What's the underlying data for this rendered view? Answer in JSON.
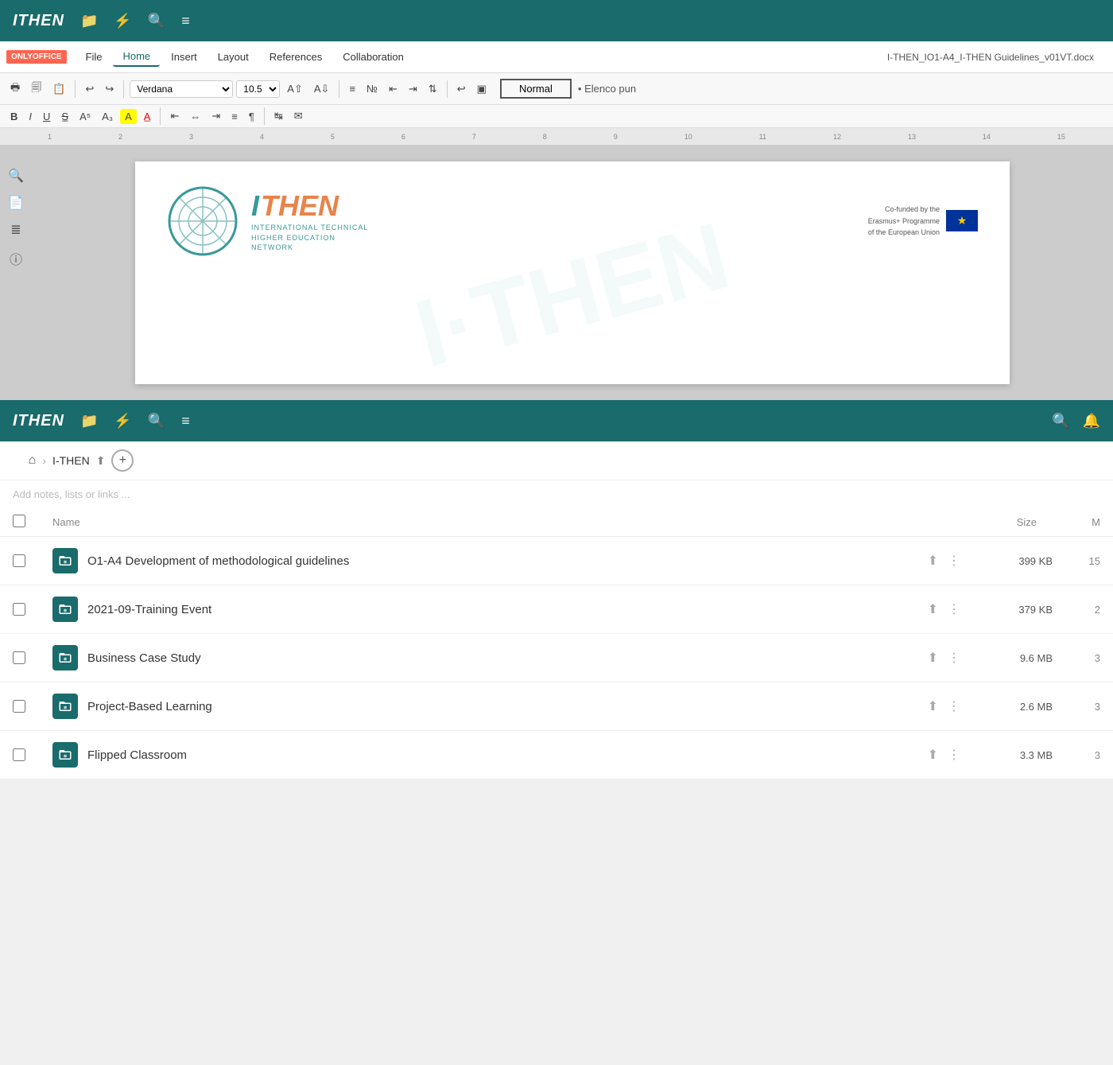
{
  "app": {
    "logo": "ITHEN",
    "icons": [
      "folder",
      "bolt",
      "search",
      "list"
    ]
  },
  "editor": {
    "onlyoffice_label": "ONLYOFFICE",
    "menu": {
      "items": [
        {
          "label": "File",
          "active": false
        },
        {
          "label": "Home",
          "active": true
        },
        {
          "label": "Insert",
          "active": false
        },
        {
          "label": "Layout",
          "active": false
        },
        {
          "label": "References",
          "active": false
        },
        {
          "label": "Collaboration",
          "active": false
        }
      ],
      "doc_title": "I-THEN_IO1-A4_I-THEN Guidelines_v01VT.docx"
    },
    "toolbar": {
      "font": "Verdana",
      "font_size": "10.5",
      "style": "Normal",
      "style2": "• Elenco pun"
    },
    "document": {
      "logo_i": "I",
      "logo_then": "THEN",
      "logo_subtitle_line1": "INTERNATIONAL TECHNICAL",
      "logo_subtitle_line2": "HIGHER EDUCATION",
      "logo_subtitle_line3": "NETWORK",
      "eu_text_line1": "Co-funded by the",
      "eu_text_line2": "Erasmus+ Programme",
      "eu_text_line3": "of the European Union",
      "watermark": "ITHEN"
    }
  },
  "filemanager": {
    "logo": "ITHEN",
    "breadcrumb": {
      "home_icon": "⌂",
      "separator": "›",
      "path_item": "I-THEN",
      "share_icon": "⇧",
      "add_icon": "+"
    },
    "notes_placeholder": "Add notes, lists or links ...",
    "table": {
      "col_name": "Name",
      "col_size": "Size",
      "col_modified": "M"
    },
    "files": [
      {
        "name": "O1-A4 Development of methodological guidelines",
        "size": "399 KB",
        "modified": "15",
        "type": "folder"
      },
      {
        "name": "2021-09-Training Event",
        "size": "379 KB",
        "modified": "2",
        "type": "folder"
      },
      {
        "name": "Business Case Study",
        "size": "9.6 MB",
        "modified": "3",
        "type": "folder"
      },
      {
        "name": "Project-Based Learning",
        "size": "2.6 MB",
        "modified": "3",
        "type": "folder"
      },
      {
        "name": "Flipped Classroom",
        "size": "3.3 MB",
        "modified": "3",
        "type": "folder"
      }
    ]
  }
}
